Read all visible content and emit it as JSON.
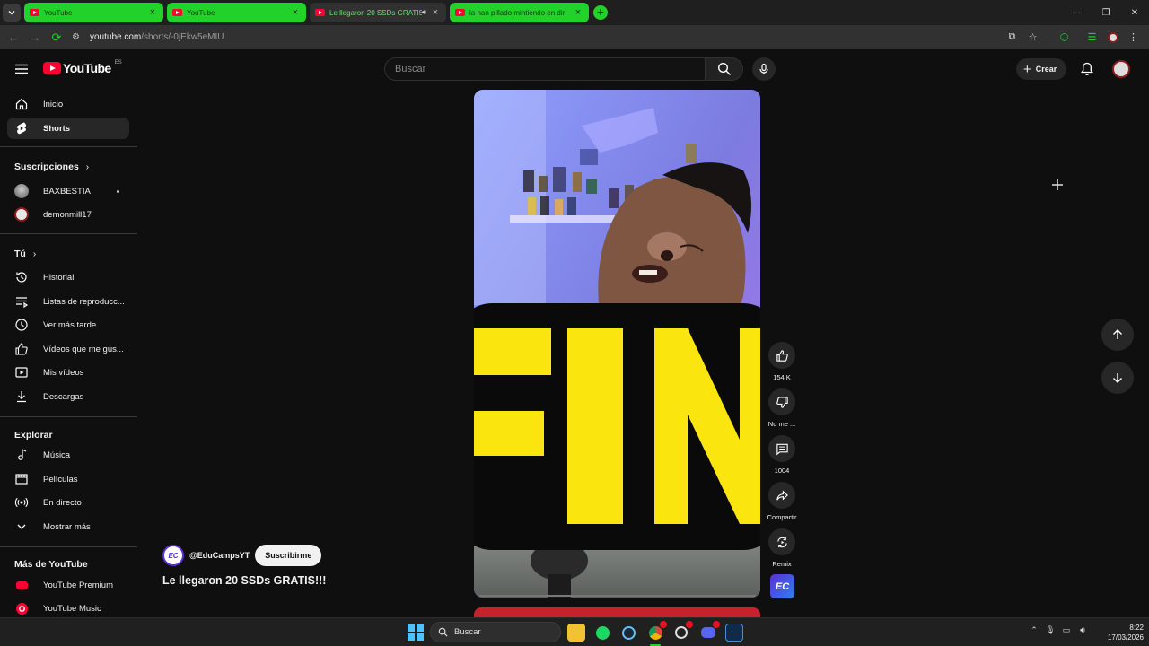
{
  "browser": {
    "tabs": [
      {
        "title": "YouTube",
        "style": "green"
      },
      {
        "title": "YouTube",
        "style": "green"
      },
      {
        "title": "Le llegaron 20 SSDs GRATIS",
        "style": "active",
        "audio": true
      },
      {
        "title": "la han pillado mintiendo en dir",
        "style": "green"
      }
    ],
    "url_host": "youtube.com",
    "url_path": "/shorts/-0jEkw5eMIU"
  },
  "masthead": {
    "logo_text": "YouTube",
    "country_code": "ES",
    "search_placeholder": "Buscar",
    "create_label": "Crear"
  },
  "sidebar": {
    "main": [
      {
        "label": "Inicio",
        "icon": "home-icon"
      },
      {
        "label": "Shorts",
        "icon": "shorts-icon",
        "selected": true
      }
    ],
    "subscriptions_header": "Suscripciones",
    "subscriptions": [
      {
        "label": "BAXBESTIA",
        "new_content": true
      },
      {
        "label": "demonmill17"
      }
    ],
    "you_header": "Tú",
    "you": [
      {
        "label": "Historial",
        "icon": "history-icon"
      },
      {
        "label": "Listas de reproducc...",
        "icon": "playlists-icon"
      },
      {
        "label": "Ver más tarde",
        "icon": "watch-later-icon"
      },
      {
        "label": "Vídeos que me gus...",
        "icon": "liked-videos-icon"
      },
      {
        "label": "Mis vídeos",
        "icon": "my-videos-icon"
      },
      {
        "label": "Descargas",
        "icon": "downloads-icon"
      }
    ],
    "explore_header": "Explorar",
    "explore": [
      {
        "label": "Música",
        "icon": "music-icon"
      },
      {
        "label": "Películas",
        "icon": "movies-icon"
      },
      {
        "label": "En directo",
        "icon": "live-icon"
      },
      {
        "label": "Mostrar más",
        "icon": "chevron-down-icon"
      }
    ],
    "more_header": "Más de YouTube",
    "more": [
      {
        "label": "YouTube Premium"
      },
      {
        "label": "YouTube Music"
      }
    ]
  },
  "short": {
    "overlay_text": "FIN",
    "channel_handle": "@EduCampsYT",
    "channel_initials": "EC",
    "subscribe_label": "Suscribirme",
    "title": "Le llegaron 20 SSDs GRATIS!!!",
    "likes": "154 K",
    "dislike_label": "No me ...",
    "comments": "1004",
    "share_label": "Compartir",
    "remix_label": "Remix"
  },
  "taskbar": {
    "search_label": "Buscar",
    "time": "8:22",
    "date": "17/03/2026"
  },
  "colors": {
    "background": "#0f0f0f",
    "accent_green": "#22d12a",
    "youtube_red": "#ff0033",
    "fin_yellow": "#fbe50e"
  }
}
